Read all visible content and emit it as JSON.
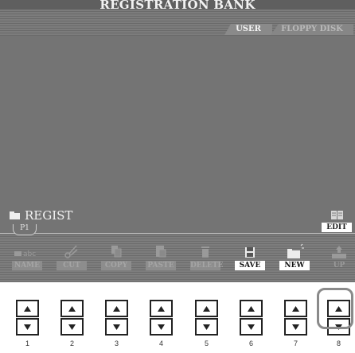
{
  "window": {
    "title": "REGISTRATION BANK"
  },
  "tabs": [
    {
      "label": "USER",
      "active": true
    },
    {
      "label": "FLOPPY DISK",
      "active": false
    }
  ],
  "file_list": {
    "folder": {
      "label": "REGIST",
      "icon": "folder-icon"
    },
    "page_tab": "P1"
  },
  "edit_button": {
    "label": "EDIT",
    "icon": "book-icon"
  },
  "function_buttons": [
    {
      "label": "NAME",
      "icon": "name-icon",
      "enabled": false
    },
    {
      "label": "CUT",
      "icon": "scissors-icon",
      "enabled": false
    },
    {
      "label": "COPY",
      "icon": "copy-icon",
      "enabled": false
    },
    {
      "label": "PASTE",
      "icon": "paste-icon",
      "enabled": false
    },
    {
      "label": "DELETE",
      "icon": "trash-icon",
      "enabled": false
    },
    {
      "label": "SAVE",
      "icon": "floppy-icon",
      "enabled": true
    },
    {
      "label": "NEW",
      "icon": "new-folder-icon",
      "enabled": true
    },
    {
      "label": "UP",
      "icon": "up-folder-icon",
      "enabled": false
    }
  ],
  "hardware_buttons": [
    {
      "number": "1"
    },
    {
      "number": "2"
    },
    {
      "number": "3"
    },
    {
      "number": "4"
    },
    {
      "number": "5"
    },
    {
      "number": "6"
    },
    {
      "number": "7"
    },
    {
      "number": "8"
    }
  ],
  "highlighted_button": "8",
  "colors": {
    "screen_bg": "#747474",
    "title_text": "#f2f2f2",
    "active_label_bg": "#ffffff",
    "inactive_label_bg": "#8d8d8d",
    "highlight_ring": "#8a8a8a"
  }
}
